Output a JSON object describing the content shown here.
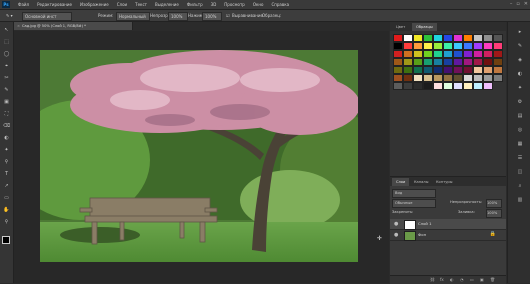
{
  "app": {
    "logo": "Ps"
  },
  "menu": [
    "Файл",
    "Редактирование",
    "Изображение",
    "Слои",
    "Текст",
    "Выделение",
    "Фильтр",
    "3D",
    "Просмотр",
    "Окно",
    "Справка"
  ],
  "window_controls": [
    "–",
    "▫",
    "✕"
  ],
  "options": {
    "mode_label": "Основной инструмент",
    "mode_value": "Основной инст",
    "blend_label": "Режим:",
    "blend_value": "Нормальный",
    "opacity_label": "Непрозр.:",
    "opacity_value": "100%",
    "flow_label": "Нажим:",
    "flow_value": "100%",
    "aligned_label": "Выравнивание",
    "sample_label": "Образец:"
  },
  "document": {
    "tab_title": "Сад.jpg @ 50% (Слой 1, RGB/8#) *",
    "close_glyph": "×"
  },
  "tools": [
    "↖",
    "⬚",
    "◯",
    "⌖",
    "✂",
    "✎",
    "▣",
    "⛶",
    "⌫",
    "◐",
    "✦",
    "⚲",
    "T",
    "↗",
    "▭",
    "✋",
    "⚲"
  ],
  "right_panel": {
    "tabs": [
      "Цвет",
      "Образцы"
    ],
    "swatch_colors": [
      "#e21b1b",
      "#ffffff",
      "#f1e826",
      "#2ec23a",
      "#1fd6e0",
      "#2547e6",
      "#e232d4",
      "#ff7f00",
      "#c6c6c6",
      "#8f8f8f",
      "#555555",
      "#000000",
      "#ff3c3c",
      "#ff9a3c",
      "#fff04a",
      "#9aef3c",
      "#3cf0a8",
      "#3cc7ff",
      "#3c78ff",
      "#a03cff",
      "#ff3cc0",
      "#ff3c78",
      "#d02020",
      "#d07020",
      "#d0c020",
      "#70d020",
      "#20d090",
      "#20a0d0",
      "#2050d0",
      "#8020d0",
      "#d020a0",
      "#d02060",
      "#a01818",
      "#a05818",
      "#a09818",
      "#58a018",
      "#18a070",
      "#1880a0",
      "#1840a0",
      "#6018a0",
      "#a01880",
      "#a01848",
      "#701010",
      "#704010",
      "#706a10",
      "#3e7010",
      "#10704e",
      "#105a70",
      "#102c70",
      "#441070",
      "#70105a",
      "#701032",
      "#f3c8a0",
      "#e0a070",
      "#c07840",
      "#a05020",
      "#703010",
      "#f0e0c0",
      "#d8c090",
      "#b89860",
      "#907040",
      "#605030",
      "#dadada",
      "#bcbcbc",
      "#9c9c9c",
      "#7c7c7c",
      "#5c5c5c",
      "#3c3c3c",
      "#2c2c2c",
      "#1c1c1c",
      "#ffe0e0",
      "#e0ffe0",
      "#e0e0ff",
      "#fff0c0",
      "#c0f0ff",
      "#f0c0ff"
    ],
    "layers_tabs": [
      "Слои",
      "Каналы",
      "Контуры"
    ],
    "filter_label": "Вид",
    "blend_mode": "Обычные",
    "opacity_label": "Непрозрачность:",
    "opacity_value": "100%",
    "lock_label": "Закрепить:",
    "fill_label": "Заливка:",
    "fill_value": "100%",
    "layers": [
      {
        "name": "Слой 1",
        "eye": "●"
      },
      {
        "name": "Фон",
        "eye": "●",
        "lock": "🔒"
      }
    ],
    "footer_icons": [
      "⛓",
      "fx",
      "◐",
      "◔",
      "▭",
      "▣",
      "🗑"
    ]
  },
  "dock_icons": [
    "▸",
    "✎",
    "◈",
    "◐",
    "✦",
    "⚙",
    "▤",
    "◎",
    "▦",
    "☰",
    "◫",
    "⌕",
    "▥"
  ],
  "colors": {
    "accent": "#34a7ff",
    "panel": "#3a3a3a",
    "canvas_bg": "#282828"
  }
}
